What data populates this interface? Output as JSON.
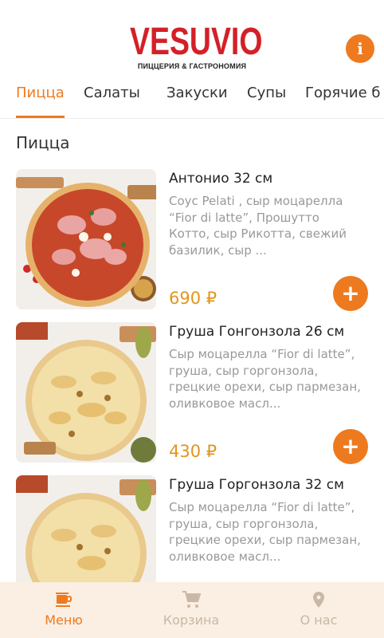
{
  "header": {
    "logo_title": "VESUVIO",
    "logo_subtitle": "ПИЦЦЕРИЯ & ГАСТРОНОМИЯ",
    "info_icon": "info-icon",
    "accent_color": "#ee7a1f",
    "brand_color": "#d42027"
  },
  "tabs": [
    {
      "label": "Пицца",
      "active": true
    },
    {
      "label": "Салаты",
      "active": false
    },
    {
      "label": "Закуски",
      "active": false
    },
    {
      "label": "Супы",
      "active": false
    },
    {
      "label": "Горячие б",
      "active": false
    }
  ],
  "section": {
    "title": "Пицца"
  },
  "products": [
    {
      "title": "Антонио 32 см",
      "description": "Соус Pelati , сыр моцарелла “Fior di latte”, Прошутто Котто, сыр Рикотта, свежий базилик, сыр ...",
      "price": "690 ₽",
      "add_label": "+"
    },
    {
      "title": "Груша Гонгонзола 26 см",
      "description": "Сыр моцарелла “Fior di latte”, груша, сыр горгонзола, грецкие орехи, сыр пармезан, оливковое масл...",
      "price": "430 ₽",
      "add_label": "+"
    },
    {
      "title": "Груша Горгонзола 32 см",
      "description": "Сыр моцарелла “Fior di latte”, груша, сыр горгонзола, грецкие орехи, сыр пармезан, оливковое масл...",
      "price": "",
      "add_label": "+"
    }
  ],
  "bottom_nav": [
    {
      "label": "Меню",
      "icon": "coffee-cup-icon",
      "active": true
    },
    {
      "label": "Корзина",
      "icon": "cart-icon",
      "active": false
    },
    {
      "label": "О нас",
      "icon": "location-pin-icon",
      "active": false
    }
  ]
}
